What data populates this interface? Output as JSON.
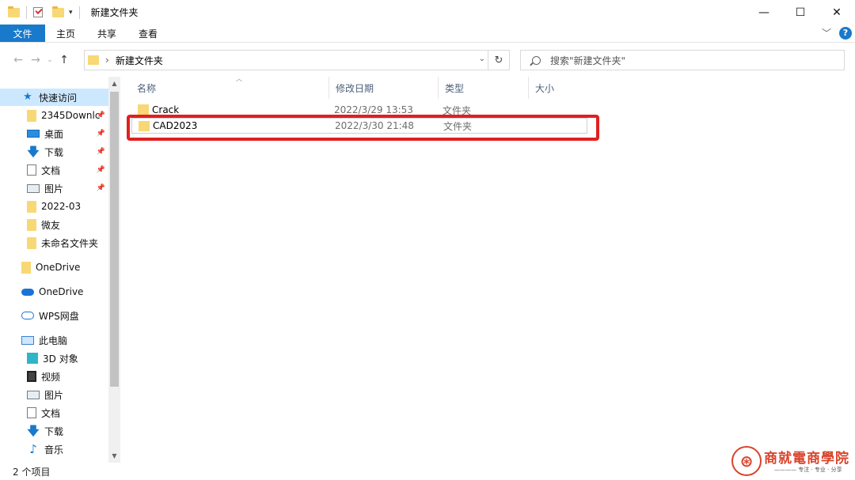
{
  "window": {
    "title": "新建文件夹",
    "controls": {
      "minimize": "—",
      "maximize": "☐",
      "close": "✕"
    }
  },
  "ribbon": {
    "tabs": [
      "文件",
      "主页",
      "共享",
      "查看"
    ],
    "help": "?"
  },
  "address": {
    "path": "新建文件夹",
    "search_placeholder": "搜索\"新建文件夹\""
  },
  "nav": {
    "items": [
      {
        "label": "快速访问",
        "icon": "star-icon",
        "selected": true
      },
      {
        "label": "2345Downlc",
        "icon": "folder-icon",
        "pinned": true
      },
      {
        "label": "桌面",
        "icon": "desktop-icon",
        "pinned": true
      },
      {
        "label": "下载",
        "icon": "download-icon",
        "pinned": true
      },
      {
        "label": "文档",
        "icon": "document-icon",
        "pinned": true
      },
      {
        "label": "图片",
        "icon": "picture-icon",
        "pinned": true
      },
      {
        "label": "2022-03",
        "icon": "folder-icon"
      },
      {
        "label": "微友",
        "icon": "folder-icon"
      },
      {
        "label": "未命名文件夹",
        "icon": "folder-icon"
      },
      {
        "label": "OneDrive",
        "icon": "folder-icon"
      },
      {
        "label": "OneDrive",
        "icon": "cloud-icon"
      },
      {
        "label": "WPS网盘",
        "icon": "cloud-outline-icon"
      },
      {
        "label": "此电脑",
        "icon": "computer-icon"
      },
      {
        "label": "3D 对象",
        "icon": "cube-icon"
      },
      {
        "label": "视频",
        "icon": "video-icon"
      },
      {
        "label": "图片",
        "icon": "picture-icon"
      },
      {
        "label": "文档",
        "icon": "document-icon"
      },
      {
        "label": "下载",
        "icon": "download-icon"
      },
      {
        "label": "音乐",
        "icon": "music-icon"
      }
    ]
  },
  "files": {
    "columns": [
      "名称",
      "修改日期",
      "类型",
      "大小"
    ],
    "rows": [
      {
        "name": "Crack",
        "date": "2022/3/29 13:53",
        "type": "文件夹"
      },
      {
        "name": "CAD2023",
        "date": "2022/3/30 21:48",
        "type": "文件夹"
      }
    ]
  },
  "status": {
    "count": "2 个项目"
  },
  "watermark": {
    "title": "商就電商學院",
    "subtitle": "———— 专注 · 专业 · 分享"
  },
  "colors": {
    "accent": "#1979ca",
    "highlight": "#e02020",
    "folder": "#f8d775"
  }
}
